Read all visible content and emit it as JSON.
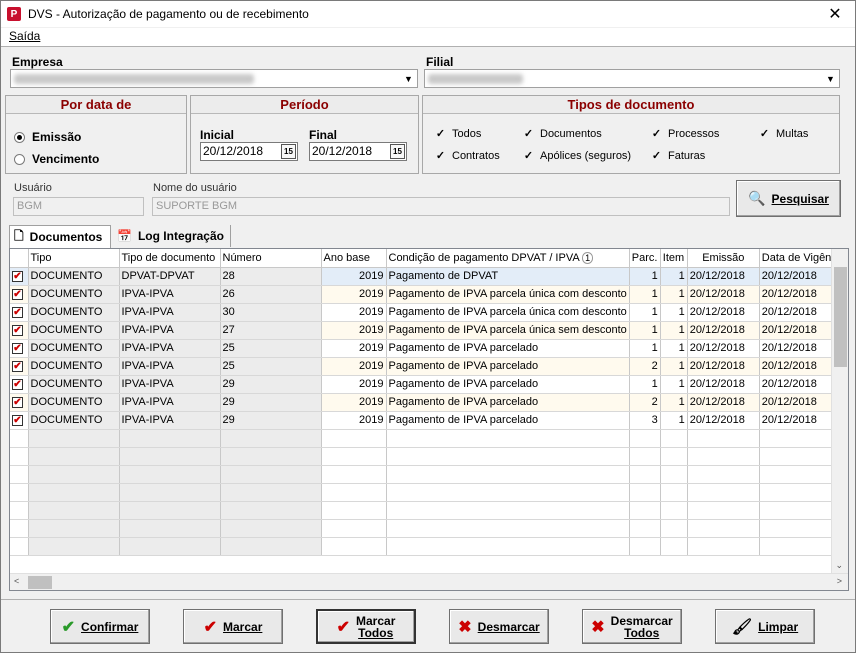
{
  "window": {
    "title": "DVS - Autorização de pagamento ou de recebimento",
    "icon_letter": "P",
    "close_glyph": "✕"
  },
  "menu": {
    "saida": "Saída"
  },
  "empresa": {
    "label": "Empresa"
  },
  "filial": {
    "label": "Filial"
  },
  "por_data": {
    "title": "Por data de",
    "emissao": "Emissão",
    "vencimento": "Vencimento",
    "selected": "Emissão"
  },
  "periodo": {
    "title": "Período",
    "inicial_label": "Inicial",
    "inicial_value": "20/12/2018",
    "final_label": "Final",
    "final_value": "20/12/2018",
    "cal_icon_text": "15"
  },
  "tipos": {
    "title": "Tipos de documento",
    "items": [
      {
        "label": "Todos",
        "checked": true
      },
      {
        "label": "Documentos",
        "checked": true
      },
      {
        "label": "Processos",
        "checked": true
      },
      {
        "label": "Multas",
        "checked": true
      },
      {
        "label": "Contratos",
        "checked": true
      },
      {
        "label": "Apólices (seguros)",
        "checked": true
      },
      {
        "label": "Faturas",
        "checked": true
      }
    ]
  },
  "usuario": {
    "label": "Usuário",
    "value": "BGM",
    "nome_label": "Nome do usuário",
    "nome_value": "SUPORTE BGM"
  },
  "pesquisar": "Pesquisar",
  "tabs": [
    {
      "label": "Documentos"
    },
    {
      "label": "Log Integração"
    }
  ],
  "grid": {
    "columns": [
      "Tipo",
      "Tipo de documento",
      "Número",
      "Ano base",
      "Condição de pagamento DPVAT / IPVA",
      "Parc.",
      "Item",
      "Emissão",
      "Data de Vigên"
    ],
    "sort_badge": "1",
    "rows": [
      [
        "DOCUMENTO",
        "DPVAT-DPVAT",
        "28",
        "2019",
        "Pagamento de DPVAT",
        "1",
        "1",
        "20/12/2018",
        "20/12/2018"
      ],
      [
        "DOCUMENTO",
        "IPVA-IPVA",
        "26",
        "2019",
        "Pagamento de IPVA parcela única com desconto",
        "1",
        "1",
        "20/12/2018",
        "20/12/2018"
      ],
      [
        "DOCUMENTO",
        "IPVA-IPVA",
        "30",
        "2019",
        "Pagamento de IPVA parcela única com desconto",
        "1",
        "1",
        "20/12/2018",
        "20/12/2018"
      ],
      [
        "DOCUMENTO",
        "IPVA-IPVA",
        "27",
        "2019",
        "Pagamento de IPVA parcela única sem desconto",
        "1",
        "1",
        "20/12/2018",
        "20/12/2018"
      ],
      [
        "DOCUMENTO",
        "IPVA-IPVA",
        "25",
        "2019",
        "Pagamento de IPVA parcelado",
        "1",
        "1",
        "20/12/2018",
        "20/12/2018"
      ],
      [
        "DOCUMENTO",
        "IPVA-IPVA",
        "25",
        "2019",
        "Pagamento de IPVA parcelado",
        "2",
        "1",
        "20/12/2018",
        "20/12/2018"
      ],
      [
        "DOCUMENTO",
        "IPVA-IPVA",
        "29",
        "2019",
        "Pagamento de IPVA parcelado",
        "1",
        "1",
        "20/12/2018",
        "20/12/2018"
      ],
      [
        "DOCUMENTO",
        "IPVA-IPVA",
        "29",
        "2019",
        "Pagamento de IPVA parcelado",
        "2",
        "1",
        "20/12/2018",
        "20/12/2018"
      ],
      [
        "DOCUMENTO",
        "IPVA-IPVA",
        "29",
        "2019",
        "Pagamento de IPVA parcelado",
        "3",
        "1",
        "20/12/2018",
        "20/12/2018"
      ]
    ]
  },
  "buttons": {
    "confirmar": "Confirmar",
    "marcar": "Marcar",
    "marcar_todos_1": "Marcar",
    "marcar_todos_2": "Todos",
    "desmarcar": "Desmarcar",
    "desmarcar_todos_1": "Desmarcar",
    "desmarcar_todos_2": "Todos",
    "limpar": "Limpar"
  },
  "colors": {
    "accent_title": "#8b0000",
    "check_red": "#cc0000",
    "selected_row": "#e3edf8",
    "alt_row": "#fffaee"
  }
}
